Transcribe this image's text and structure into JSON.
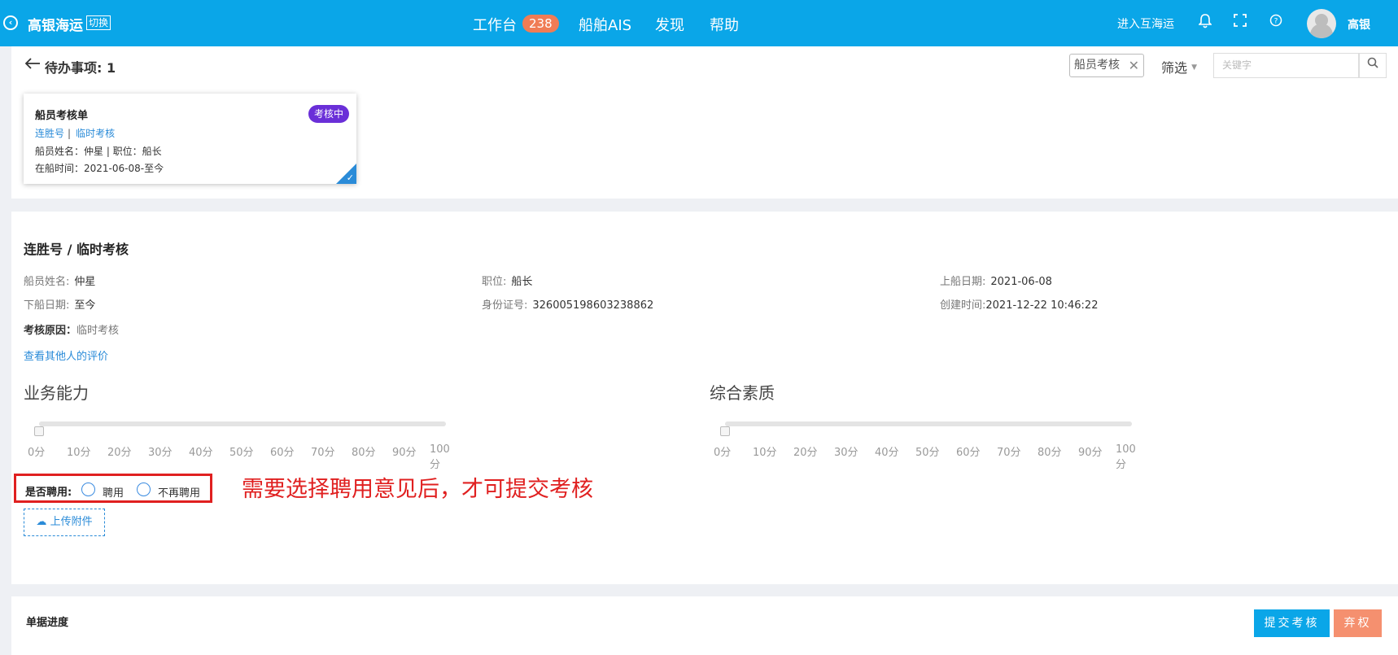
{
  "header": {
    "brand": "高银海运",
    "switch_label": "切换",
    "nav": [
      {
        "label": "工作台",
        "badge": "238"
      },
      {
        "label": "船舶AIS"
      },
      {
        "label": "发现"
      },
      {
        "label": "帮助"
      }
    ],
    "enter_label": "进入互海运",
    "icons": [
      "bell-icon",
      "fullscreen-icon",
      "help-icon"
    ],
    "user_name": "高银"
  },
  "todo": {
    "title": "待办事项: 1",
    "filter_tag": "船员考核",
    "filter_label": "筛选",
    "search_placeholder": "关键字"
  },
  "card": {
    "title": "船员考核单",
    "status": "考核中",
    "status_color": "#6a2fd8",
    "ship": "连胜号",
    "type": "临时考核",
    "line1": "船员姓名：仲星 | 职位：船长",
    "line2": "在船时间：2021-06-08-至今"
  },
  "detail": {
    "title": "连胜号 / 临时考核",
    "fields": [
      {
        "label": "船员姓名:",
        "value": "仲星"
      },
      {
        "label": "职位:",
        "value": "船长"
      },
      {
        "label": "上船日期:",
        "value": "2021-06-08"
      },
      {
        "label": "下船日期:",
        "value": "至今"
      },
      {
        "label": "身份证号:",
        "value": "326005198603238862"
      },
      {
        "label": "创建时间:",
        "value": "2021-12-22 10:46:22"
      }
    ],
    "reason_label": "考核原因：",
    "reason_value": "临时考核",
    "view_others_link": "查看其他人的评价",
    "business_ability": {
      "label": "业务能力",
      "value": 0
    },
    "overall_quality": {
      "label": "综合素质",
      "value": 0
    },
    "scale_ticks": [
      "0分",
      "10分",
      "20分",
      "30分",
      "40分",
      "50分",
      "60分",
      "70分",
      "80分",
      "90分",
      "100分"
    ],
    "hire_label": "是否聘用:",
    "hire_options": [
      "聘用",
      "不再聘用"
    ],
    "note": "需要选择聘用意见后，才可提交考核",
    "upload_label": "上传附件"
  },
  "footer": {
    "progress_title": "单据进度",
    "submit_label": "提交考核",
    "waive_label": "弃权"
  }
}
